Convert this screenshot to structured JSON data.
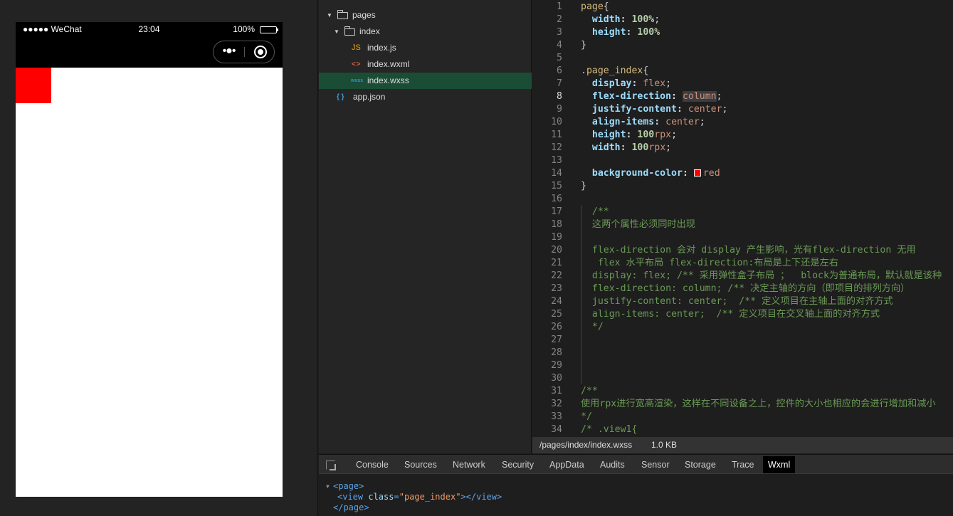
{
  "simulator": {
    "carrier": "●●●●● WeChat",
    "time": "23:04",
    "battery": "100%",
    "more_label": "•●•",
    "content_box_color": "#ff0000"
  },
  "file_tree": {
    "items": [
      {
        "label": "pages",
        "type": "folder",
        "expanded": true
      },
      {
        "label": "index",
        "type": "folder",
        "expanded": true
      },
      {
        "label": "index.js",
        "type": "js",
        "icon_text": "JS"
      },
      {
        "label": "index.wxml",
        "type": "wxml",
        "icon_text": "< >"
      },
      {
        "label": "index.wxss",
        "type": "wxss",
        "icon_text": "wxss",
        "selected": true
      },
      {
        "label": "app.json",
        "type": "json",
        "icon_text": "{ }"
      }
    ]
  },
  "editor": {
    "line_numbers": [
      "1",
      "2",
      "3",
      "4",
      "5",
      "6",
      "7",
      "8",
      "9",
      "10",
      "11",
      "12",
      "13",
      "14",
      "15",
      "16",
      "17",
      "18",
      "19",
      "20",
      "21",
      "22",
      "23",
      "24",
      "25",
      "26",
      "27",
      "28",
      "29",
      "30",
      "31",
      "32",
      "33",
      "34"
    ],
    "active_line": "8",
    "code": {
      "l1_sel": "page",
      "l1_brace": "{",
      "l2_prop": "width",
      "l2_val": "100%",
      "l3_prop": "height",
      "l3_val": "100%",
      "l4": "}",
      "l6_sel": ".page_index",
      "l6_brace": "{",
      "l7_prop": "display",
      "l7_val": "flex",
      "l8_prop": "flex-direction",
      "l8_val": "column",
      "l9_prop": "justify-content",
      "l9_val": "center",
      "l10_prop": "align-items",
      "l10_val": "center",
      "l11_prop": "height",
      "l11_num": "100",
      "l11_unit": "rpx",
      "l12_prop": "width",
      "l12_num": "100",
      "l12_unit": "rpx",
      "l14_prop": "background-color",
      "l14_val": "red",
      "l15": "}",
      "l17": "  /**",
      "l18": "  这两个属性必须同时出现",
      "l20": "  flex-direction 会对 display 产生影响，光有flex-direction 无用",
      "l21": "   flex 水平布局 flex-direction:布局是上下还是左右",
      "l22": "  display: flex; /** 采用弹性盒子布局 ；  block为普通布局，默认就是该种",
      "l23": "  flex-direction: column; /** 决定主轴的方向（即项目的排列方向）",
      "l24": "  justify-content: center;  /** 定义项目在主轴上面的对齐方式",
      "l25": "  align-items: center;  /** 定义项目在交叉轴上面的对齐方式",
      "l26": "  */",
      "l31": "/**",
      "l32": "使用rpx进行宽高渲染，这样在不同设备之上，控件的大小也相应的会进行增加和减小",
      "l33": "*/",
      "l34": "/* .view1{"
    }
  },
  "editor_status": {
    "path": "/pages/index/index.wxss",
    "size": "1.0 KB"
  },
  "devtools": {
    "tabs": [
      "Console",
      "Sources",
      "Network",
      "Security",
      "AppData",
      "Audits",
      "Sensor",
      "Storage",
      "Trace",
      "Wxml"
    ],
    "active_tab": "Wxml",
    "wxml": {
      "open_page": "<page>",
      "view_open": "<view",
      "attr_name": "class",
      "attr_eq": "=",
      "attr_value": "\"page_index\"",
      "view_close": "></view>",
      "close_page": "</page>"
    }
  },
  "colors": {
    "editor_bg": "#1e1e1e",
    "selected_file_bg": "#1b4d36",
    "selector": "#d7ba7d",
    "property": "#9cdcfe",
    "number": "#b5cea8",
    "value": "#ce9178",
    "comment": "#6a9955"
  }
}
